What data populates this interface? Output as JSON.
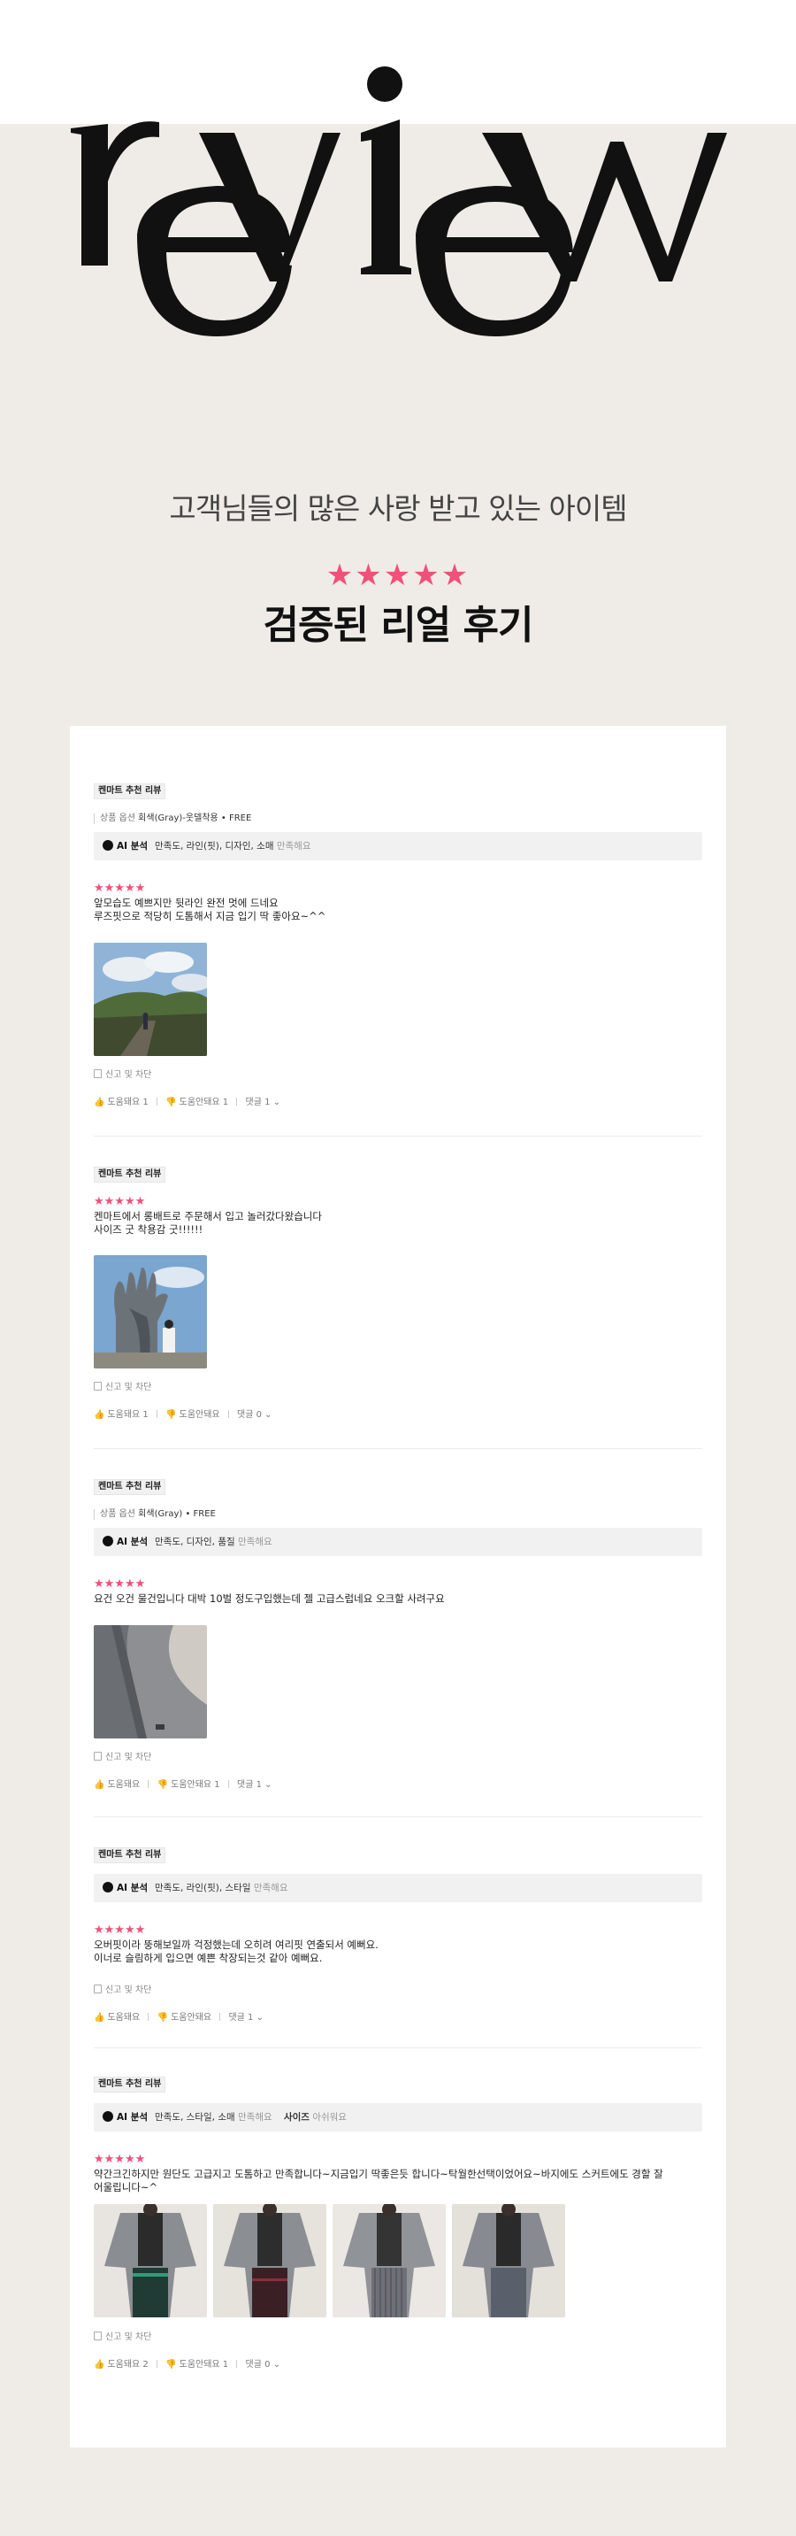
{
  "hero": {
    "logo_text": "review",
    "subtitle": "고객님들의 많은 사랑 받고 있는 아이템",
    "stars": "★★★★★",
    "headline": "검증된 리얼 후기"
  },
  "colors": {
    "star": "#f0507a",
    "background": "#efece7",
    "panel": "#ffffff"
  },
  "reviews": [
    {
      "badge": "켄마트 추천 리뷰",
      "option_label": "상품 옵션",
      "option_value": "회색(Gray)-웃델착용 • FREE",
      "ai_title": "AI 분석",
      "ai_keywords": "만족도, 라인(핏), 디자인, 소매",
      "ai_status": "만족해요",
      "stars": "★★★★★",
      "text": "앞모습도 예쁘지만 뒷라인 완전 멋에 드네요\n루즈핏으로 적당히 도톰해서 지금 입기 딱 좋아요~^^",
      "report": "신고 및 차단",
      "helpful": "도움돼요 1",
      "not_helpful": "도움안돼요 1",
      "comments": "댓글 1"
    },
    {
      "badge": "켄마트 추천 리뷰",
      "stars": "★★★★★",
      "text": "켄마트에서 롱배트로 주문해서 입고 놀러갔다왔습니다\n사이즈 굿 착용감 굿!!!!!!",
      "report": "신고 및 차단",
      "helpful": "도움돼요 1",
      "not_helpful": "도움안돼요",
      "comments": "댓글 0"
    },
    {
      "badge": "켄마트 추천 리뷰",
      "option_label": "상품 옵션",
      "option_value": "회색(Gray) • FREE",
      "ai_title": "AI 분석",
      "ai_keywords": "만족도, 디자인, 품질",
      "ai_status": "만족해요",
      "stars": "★★★★★",
      "text": "요건 오건 물건입니다 대박 10벌 정도구입했는데 젤 고급스럽네요 오크할 사려구요",
      "report": "신고 및 차단",
      "helpful": "도움돼요",
      "not_helpful": "도움안돼요 1",
      "comments": "댓글 1"
    },
    {
      "badge": "켄마트 추천 리뷰",
      "ai_title": "AI 분석",
      "ai_keywords": "만족도, 라인(핏), 스타일",
      "ai_status": "만족해요",
      "stars": "★★★★★",
      "text": "오버핏이라 뚱해보일까 걱정했는데 오히려 여리핏 연출되서 예뻐요.\n이너로 슬림하게 입으면 예쁜 착장되는것 같아 예뻐요.",
      "report": "신고 및 차단",
      "helpful": "도움돼요",
      "not_helpful": "도움안돼요",
      "comments": "댓글 1"
    },
    {
      "badge": "켄마트 추천 리뷰",
      "ai_title": "AI 분석",
      "ai_keywords": "만족도, 스타일, 소매",
      "ai_status": "만족해요",
      "ai_size_label": "사이즈",
      "ai_size_status": "아쉬워요",
      "stars": "★★★★★",
      "text": "약간크긴하지만 원단도 고급지고 도톰하고 만족합니다~지금입기 딱좋은듯 합니다~탁월한선택이었어요~바지에도 스커트에도 경할 잘\n어울립니다~^",
      "report": "신고 및 차단",
      "helpful": "도움돼요 2",
      "not_helpful": "도움안돼요 1",
      "comments": "댓글 0"
    }
  ]
}
